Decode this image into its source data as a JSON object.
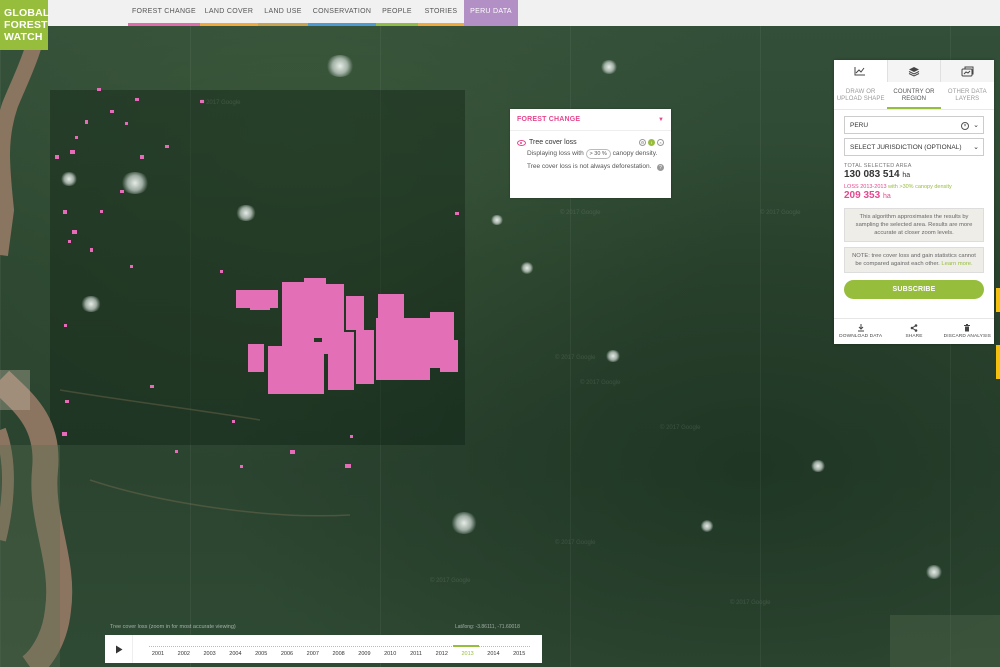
{
  "logo": {
    "line1": "GLOBAL",
    "line2": "FOREST",
    "line3": "WATCH"
  },
  "nav": {
    "tabs": [
      {
        "label": "FOREST CHANGE",
        "color": "#e06cae"
      },
      {
        "label": "LAND COVER",
        "color": "#f2a93b"
      },
      {
        "label": "LAND USE",
        "color": "#c9a44d"
      },
      {
        "label": "CONSERVATION",
        "color": "#4d9bd5"
      },
      {
        "label": "PEOPLE",
        "color": "#8fbd46"
      },
      {
        "label": "STORIES",
        "color": "#f2a93b"
      },
      {
        "label": "PERU DATA",
        "color": "#b28fc5"
      }
    ],
    "active_tab": "PERU DATA"
  },
  "legend": {
    "title": "FOREST CHANGE",
    "collapse_icon": "caret-down-icon",
    "layer_name": "Tree cover loss",
    "desc_prefix": "Displaying loss with",
    "threshold": "> 30 %",
    "desc_suffix": "canopy density.",
    "note": "Tree cover loss is not always deforestation.",
    "accent_color": "#e6478f"
  },
  "panel": {
    "icon_tabs": [
      "chart-icon",
      "layers-icon",
      "analysis-icon"
    ],
    "subtabs": [
      "DRAW OR UPLOAD SHAPE",
      "COUNTRY OR REGION",
      "OTHER DATA LAYERS"
    ],
    "active_subtab": "COUNTRY OR REGION",
    "country": "PERU",
    "jurisdiction_placeholder": "SELECT JURISDICTION (OPTIONAL)",
    "total_label": "TOTAL SELECTED AREA",
    "total_value": "130 083 514",
    "unit": "ha",
    "loss_label": "LOSS 2013-2013",
    "loss_density": "with >30% canopy density",
    "loss_value": "209 353",
    "info_text": "This algorithm approximates the results by sampling the selected area. Results are more accurate at closer zoom levels.",
    "note_text": "NOTE: tree cover loss and gain statistics cannot be compared against each other.",
    "note_link": "Learn more.",
    "subscribe_label": "SUBSCRIBE",
    "actions": [
      "DOWNLOAD DATA",
      "SHARE",
      "DISCARD ANALYSIS"
    ],
    "accent_green": "#97bd3d",
    "accent_pink": "#e6478f"
  },
  "map": {
    "hint": "Tree cover loss (zoom in for most accurate viewing)",
    "coords": "Lat/long: -3.86111, -71.60018",
    "watermark": "© 2017 Google"
  },
  "timeline": {
    "years": [
      "2001",
      "2002",
      "2003",
      "2004",
      "2005",
      "2006",
      "2007",
      "2008",
      "2009",
      "2010",
      "2011",
      "2012",
      "2013",
      "2014",
      "2015"
    ],
    "selected_year": "2013",
    "play_icon": "play-icon"
  }
}
